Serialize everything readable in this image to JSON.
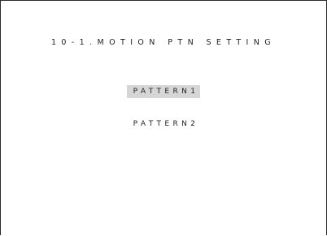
{
  "screen": {
    "title": "10-1.MOTION PTN SETTING"
  },
  "menu": {
    "selected_index": 0,
    "items": [
      {
        "label": "PATTERN1"
      },
      {
        "label": "PATTERN2"
      }
    ],
    "highlight_color": "#d6d6d6"
  }
}
